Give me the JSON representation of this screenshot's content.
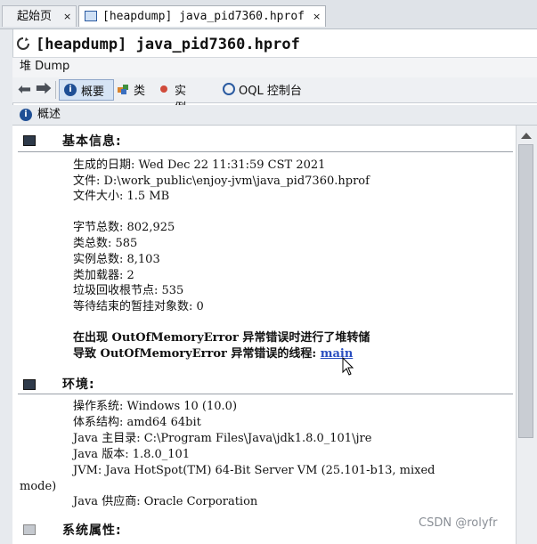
{
  "tabs": [
    {
      "label": "起始页",
      "close": "×"
    },
    {
      "label": "[heapdump] java_pid7360.hprof",
      "close": "×"
    }
  ],
  "document_title": "[heapdump] java_pid7360.hprof",
  "subtoolbar_label": "堆 Dump",
  "toolbar": {
    "summary": "概要",
    "classes": "类",
    "instances": "实例数",
    "oql": "OQL 控制台"
  },
  "overview_label": "概述",
  "basic_info": {
    "title": "基本信息:",
    "generated": "生成的日期: Wed Dec 22 11:31:59 CST 2021",
    "file": "文件: D:\\work_public\\enjoy-jvm\\java_pid7360.hprof",
    "size": "文件大小: 1.5 MB",
    "total_bytes": "字节总数: 802,925",
    "total_classes": "类总数: 585",
    "total_instances": "实例总数: 8,103",
    "classloaders": "类加载器: 2",
    "gc_roots": "垃圾回收根节点: 535",
    "finalizers": "等待结束的暂挂对象数: 0",
    "oom_line1": "在出现 OutOfMemoryError 异常错误时进行了堆转储",
    "oom_line2_prefix": "导致 OutOfMemoryError 异常错误的线程: ",
    "oom_thread_link": "main"
  },
  "environment": {
    "title": "环境:",
    "os": "操作系统: Windows 10 (10.0)",
    "arch": "体系结构: amd64 64bit",
    "java_home": "Java 主目录: C:\\Program Files\\Java\\jdk1.8.0_101\\jre",
    "java_version": "Java 版本: 1.8.0_101",
    "jvm": "JVM: Java HotSpot(TM) 64-Bit Server VM (25.101-b13, mixed",
    "jvm_wrap": "mode)",
    "java_vendor": "Java 供应商: Oracle Corporation"
  },
  "system_properties": {
    "title": "系统属性:"
  },
  "watermark": "CSDN @rolyfr"
}
